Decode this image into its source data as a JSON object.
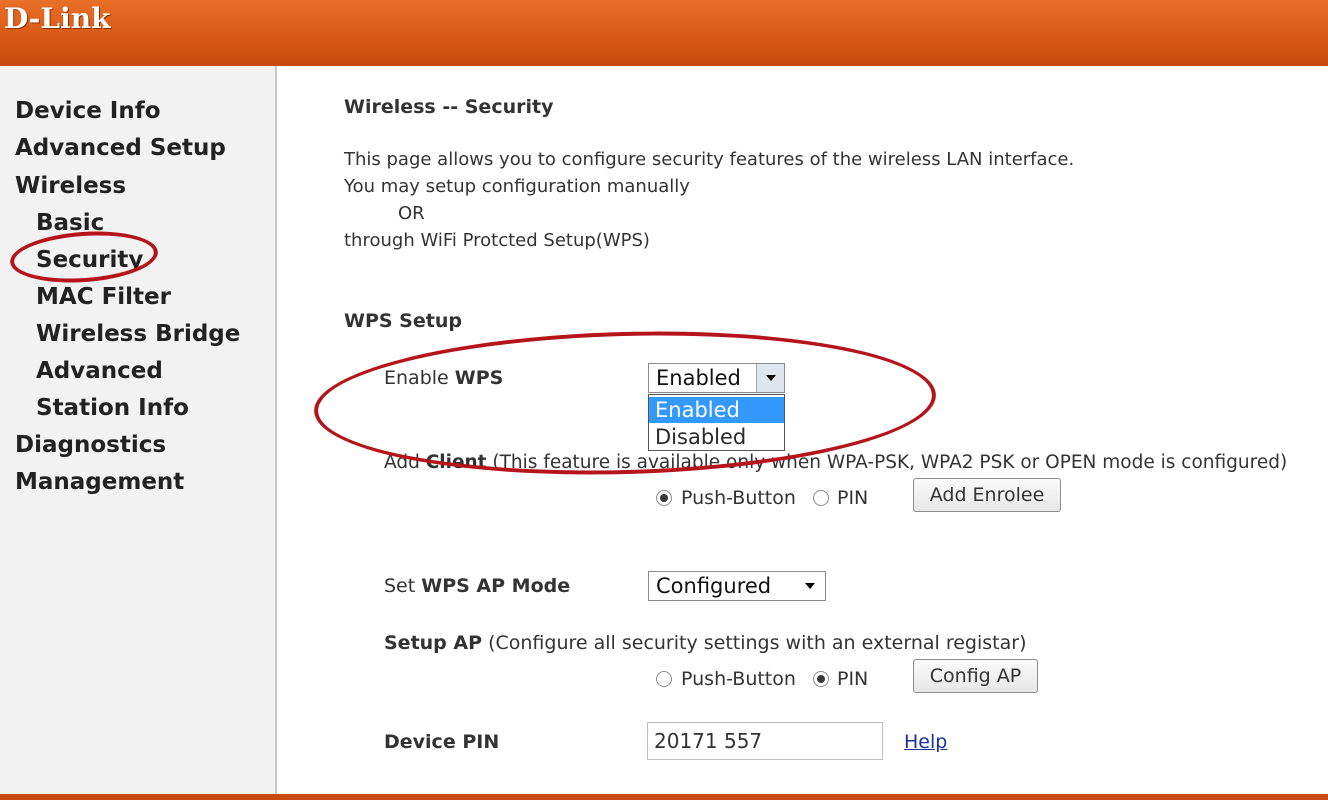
{
  "header": {
    "logo_text": "D-Link",
    "color": "#d85a14"
  },
  "sidebar": {
    "items": [
      {
        "label": "Device Info"
      },
      {
        "label": "Advanced Setup"
      },
      {
        "label": "Wireless"
      },
      {
        "label": "Basic"
      },
      {
        "label": "Security"
      },
      {
        "label": "MAC Filter"
      },
      {
        "label": "Wireless Bridge"
      },
      {
        "label": "Advanced"
      },
      {
        "label": "Station Info"
      },
      {
        "label": "Diagnostics"
      },
      {
        "label": "Management"
      }
    ]
  },
  "main": {
    "title": "Wireless -- Security",
    "intro": [
      "This page allows you to configure security features of the wireless LAN interface.",
      "You may setup configuration manually",
      "OR",
      "through WiFi Protcted Setup(WPS)"
    ],
    "wps_setup": {
      "heading": "WPS Setup",
      "enable_label_prefix": "Enable ",
      "enable_label_bold": "WPS",
      "enable_value": "Enabled",
      "enable_options": [
        "Enabled",
        "Disabled"
      ],
      "add_client_prefix": "Add ",
      "add_client_bold": "Client",
      "add_client_note": " (This feature is available only when WPA-PSK, WPA2 PSK or OPEN mode is configured)",
      "push_button_label": "Push-Button",
      "pin_label": "PIN",
      "add_enrolee_button": "Add Enrolee",
      "ap_mode_prefix": "Set ",
      "ap_mode_bold": "WPS AP Mode",
      "ap_mode_value": "Configured",
      "setup_ap_bold": "Setup AP",
      "setup_ap_note": " (Configure all security settings with an external registar)",
      "config_ap_button": "Config AP",
      "device_pin_label": "Device PIN",
      "device_pin_value": "20171 557",
      "help_link": "Help"
    }
  }
}
